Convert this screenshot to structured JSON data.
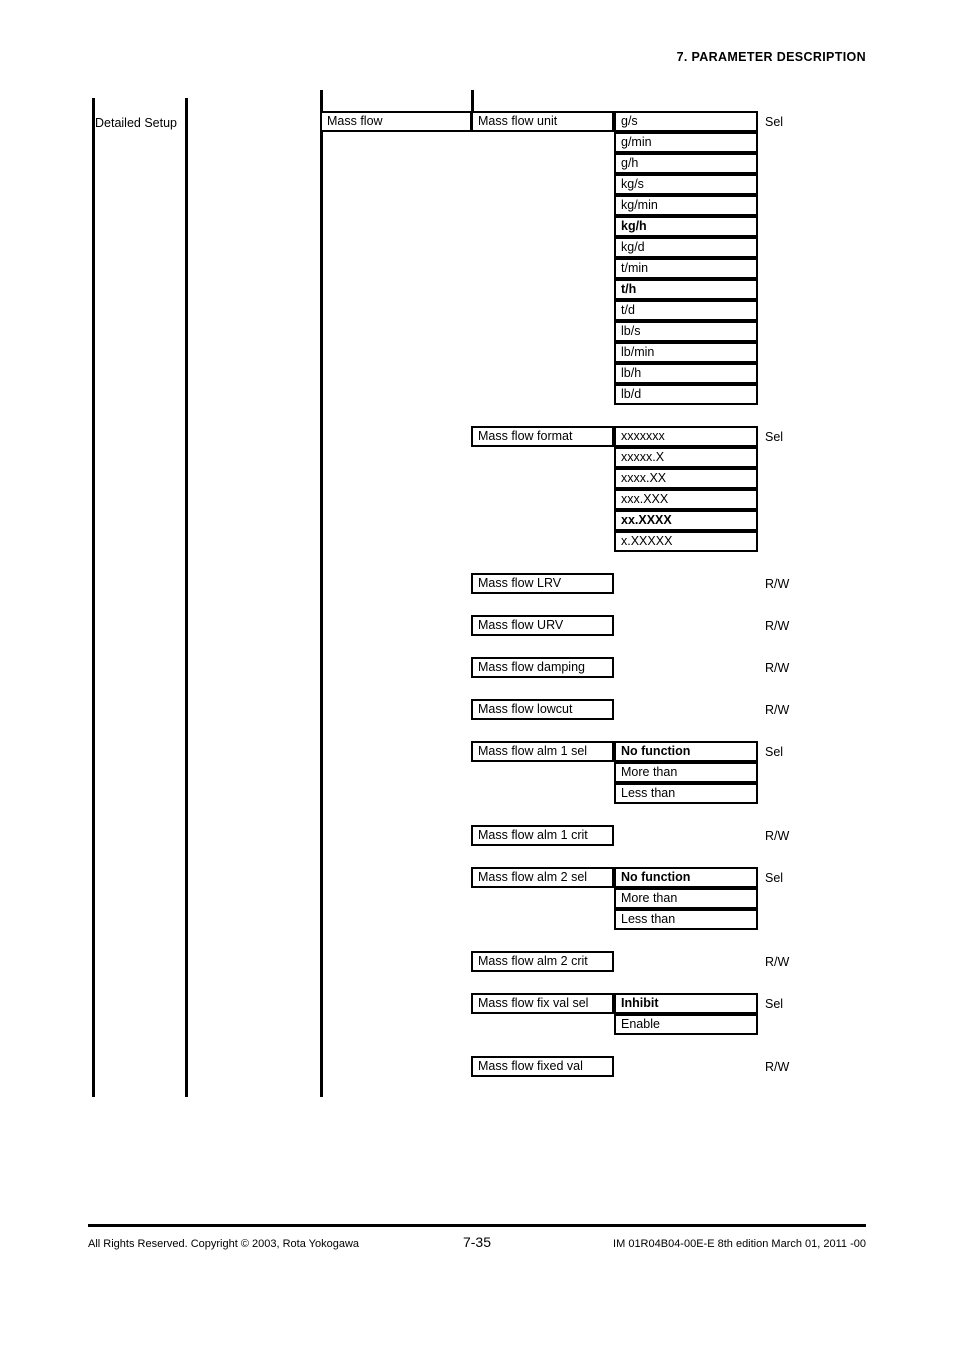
{
  "header": {
    "section": "7.  PARAMETER DESCRIPTION"
  },
  "tree": {
    "level1_label": "Detailed Setup",
    "level3_label": "Mass flow"
  },
  "access": {
    "select": "Sel",
    "read_write": "R/W"
  },
  "parameters": [
    {
      "name": "Mass flow unit",
      "access": "Sel",
      "options": [
        {
          "label": "g/s",
          "default": false
        },
        {
          "label": "g/min",
          "default": false
        },
        {
          "label": "g/h",
          "default": false
        },
        {
          "label": "kg/s",
          "default": false
        },
        {
          "label": "kg/min",
          "default": false
        },
        {
          "label": "kg/h",
          "default": true
        },
        {
          "label": "kg/d",
          "default": false
        },
        {
          "label": "t/min",
          "default": false
        },
        {
          "label": "t/h",
          "default": true
        },
        {
          "label": "t/d",
          "default": false
        },
        {
          "label": "lb/s",
          "default": false
        },
        {
          "label": "lb/min",
          "default": false
        },
        {
          "label": "lb/h",
          "default": false
        },
        {
          "label": "lb/d",
          "default": false
        }
      ]
    },
    {
      "name": "Mass flow format",
      "access": "Sel",
      "options": [
        {
          "label": "xxxxxxx",
          "default": false
        },
        {
          "label": "xxxxx.X",
          "default": false
        },
        {
          "label": "xxxx.XX",
          "default": false
        },
        {
          "label": "xxx.XXX",
          "default": false
        },
        {
          "label": "xx.XXXX",
          "default": true
        },
        {
          "label": "x.XXXXX",
          "default": false
        }
      ]
    },
    {
      "name": "Mass flow LRV",
      "access": "R/W",
      "options": []
    },
    {
      "name": "Mass flow URV",
      "access": "R/W",
      "options": []
    },
    {
      "name": "Mass flow damping",
      "access": "R/W",
      "options": []
    },
    {
      "name": "Mass flow lowcut",
      "access": "R/W",
      "options": []
    },
    {
      "name": "Mass flow alm 1 sel",
      "access": "Sel",
      "options": [
        {
          "label": "No function",
          "default": true
        },
        {
          "label": "More than",
          "default": false
        },
        {
          "label": "Less than",
          "default": false
        }
      ]
    },
    {
      "name": "Mass flow alm 1 crit",
      "access": "R/W",
      "options": []
    },
    {
      "name": "Mass flow alm 2 sel",
      "access": "Sel",
      "options": [
        {
          "label": "No function",
          "default": true
        },
        {
          "label": "More than",
          "default": false
        },
        {
          "label": "Less than",
          "default": false
        }
      ]
    },
    {
      "name": "Mass flow alm 2 crit",
      "access": "R/W",
      "options": []
    },
    {
      "name": "Mass flow fix val sel",
      "access": "Sel",
      "options": [
        {
          "label": "Inhibit",
          "default": true
        },
        {
          "label": "Enable",
          "default": false
        }
      ]
    },
    {
      "name": "Mass flow fixed val",
      "access": "R/W",
      "options": []
    }
  ],
  "footer": {
    "copyright": "All Rights Reserved. Copyright © 2003, Rota Yokogawa",
    "page_number": "7-35",
    "document_id": "IM 01R04B04-00E-E  8th edition March 01, 2011 -00"
  }
}
